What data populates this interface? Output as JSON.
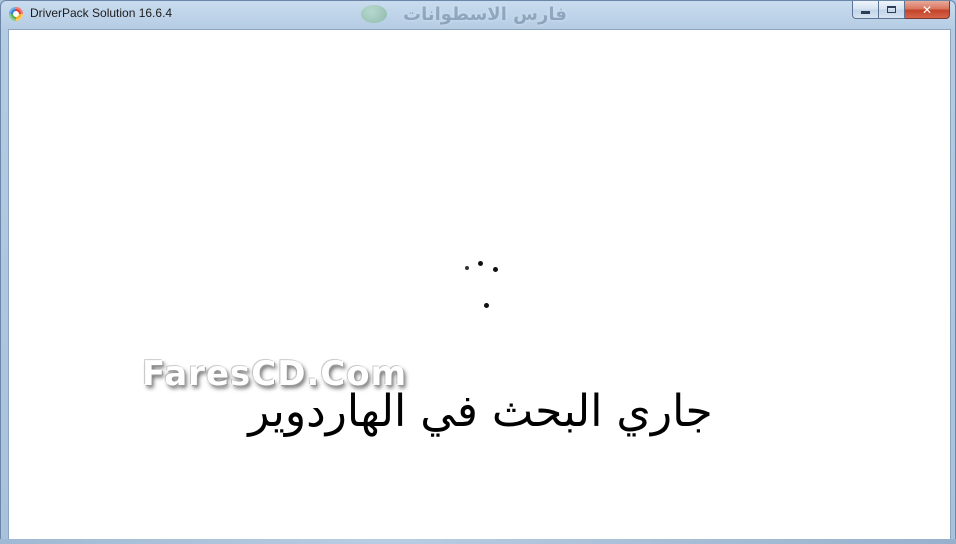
{
  "window": {
    "title": "DriverPack Solution 16.6.4",
    "header_watermark": "فارس الاسطوانات",
    "caption": {
      "minimize_icon": "minimize-icon",
      "maximize_icon": "maximize-icon",
      "close_icon": "close-icon",
      "close_glyph": "✕"
    },
    "accent_color": "#c4432a"
  },
  "content": {
    "watermark_brand": "FaresCD.Com",
    "status_message": "جاري البحث في الهاردوير",
    "spinner_icon": "loading-dots-icon"
  }
}
